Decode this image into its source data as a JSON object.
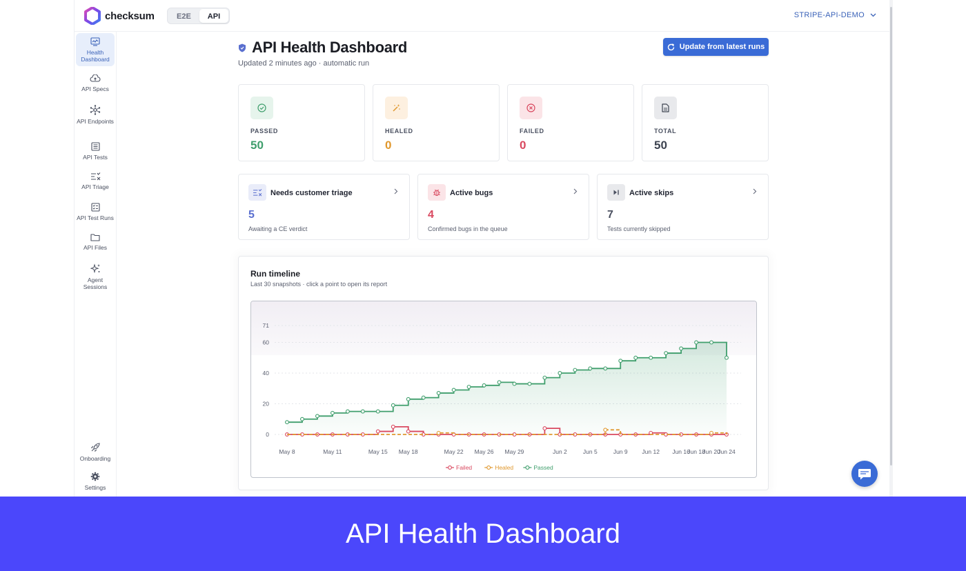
{
  "app": {
    "brand": "checksum",
    "mode_tabs": [
      "E2E",
      "API"
    ],
    "active_mode": "API",
    "project": "STRIPE-API-DEMO"
  },
  "sidebar": {
    "items": [
      {
        "label": "Health Dashboard",
        "icon": "health-dashboard-icon"
      },
      {
        "label": "API Specs",
        "icon": "cloud-upload-icon"
      },
      {
        "label": "API Endpoints",
        "icon": "network-icon"
      },
      {
        "label": "API Tests",
        "icon": "list-icon"
      },
      {
        "label": "API Triage",
        "icon": "triage-icon"
      },
      {
        "label": "API Test Runs",
        "icon": "checklist-icon"
      },
      {
        "label": "API Files",
        "icon": "folder-icon"
      },
      {
        "label": "Agent Sessions",
        "icon": "sparkle-icon"
      }
    ],
    "bottom_items": [
      {
        "label": "Onboarding",
        "icon": "rocket-icon"
      },
      {
        "label": "Settings",
        "icon": "gear-icon"
      }
    ]
  },
  "header": {
    "title": "API Health Dashboard",
    "subtitle": "Updated 2 minutes ago · automatic run",
    "update_button": "Update from latest runs"
  },
  "stats": [
    {
      "label": "PASSED",
      "value": "50",
      "color": "#3f9e6c",
      "bg": "#e6f4ec",
      "icon": "check-circle-icon"
    },
    {
      "label": "HEALED",
      "value": "0",
      "color": "#e0982e",
      "bg": "#fdf0e0",
      "icon": "magic-wand-icon"
    },
    {
      "label": "FAILED",
      "value": "0",
      "color": "#d9485f",
      "bg": "#fbe4e7",
      "icon": "x-circle-icon"
    },
    {
      "label": "TOTAL",
      "value": "50",
      "color": "#3d4350",
      "bg": "#e8e9ec",
      "icon": "document-icon"
    }
  ],
  "cards": [
    {
      "title": "Needs customer triage",
      "value": "5",
      "desc": "Awaiting a CE verdict",
      "color": "#5a6fcf",
      "bg": "#e9ecf9",
      "icon": "triage-icon"
    },
    {
      "title": "Active bugs",
      "value": "4",
      "desc": "Confirmed bugs in the queue",
      "color": "#d9485f",
      "bg": "#fbe4e7",
      "icon": "bug-icon"
    },
    {
      "title": "Active skips",
      "value": "7",
      "desc": "Tests currently skipped",
      "color": "#4a5060",
      "bg": "#e8e9ec",
      "icon": "skip-icon"
    }
  ],
  "timeline": {
    "title": "Run timeline",
    "subtitle": "Last 30 snapshots · click a point to open its report"
  },
  "chart_data": {
    "type": "line",
    "step": true,
    "x": [
      "May 8",
      "May 9",
      "May 10",
      "May 11",
      "May 13",
      "May 14",
      "May 15",
      "May 17",
      "May 18",
      "May 19",
      "May 21",
      "May 22",
      "May 24",
      "May 26",
      "May 27",
      "May 29",
      "May 30",
      "Jun 1",
      "Jun 2",
      "Jun 4",
      "Jun 5",
      "Jun 7",
      "Jun 9",
      "Jun 10",
      "Jun 12",
      "Jun 14",
      "Jun 16",
      "Jun 18",
      "Jun 20",
      "Jun 24"
    ],
    "x_tick_labels": [
      "May 8",
      "May 11",
      "May 15",
      "May 18",
      "May 22",
      "May 26",
      "May 29",
      "Jun 2",
      "Jun 5",
      "Jun 9",
      "Jun 12",
      "Jun 16",
      "Jun 18",
      "Jun 20",
      "Jun 24"
    ],
    "y_ticks": [
      0,
      20,
      40,
      60,
      71
    ],
    "ylim": [
      0,
      71
    ],
    "grid": true,
    "legend_position": "bottom",
    "series": [
      {
        "name": "Failed",
        "color": "#d9485f",
        "values": [
          0,
          0,
          0,
          0,
          0,
          0,
          2,
          5,
          2,
          0,
          0,
          0,
          0,
          0,
          0,
          0,
          0,
          4,
          0,
          0,
          0,
          0,
          0,
          0,
          1,
          0,
          0,
          0,
          0,
          0
        ]
      },
      {
        "name": "Healed",
        "color": "#e0982e",
        "values": [
          0,
          0,
          0,
          0,
          0,
          0,
          0,
          0,
          0,
          0,
          1,
          0,
          0,
          0,
          0,
          0,
          0,
          0,
          0,
          0,
          0,
          3,
          0,
          0,
          0,
          0,
          0,
          0,
          1,
          0
        ]
      },
      {
        "name": "Passed",
        "color": "#3f9e6c",
        "values": [
          8,
          10,
          12,
          14,
          15,
          15,
          15,
          19,
          23,
          24,
          27,
          29,
          31,
          32,
          34,
          33,
          33,
          37,
          40,
          42,
          43,
          43,
          48,
          50,
          50,
          53,
          56,
          60,
          60,
          50
        ]
      }
    ]
  }
}
